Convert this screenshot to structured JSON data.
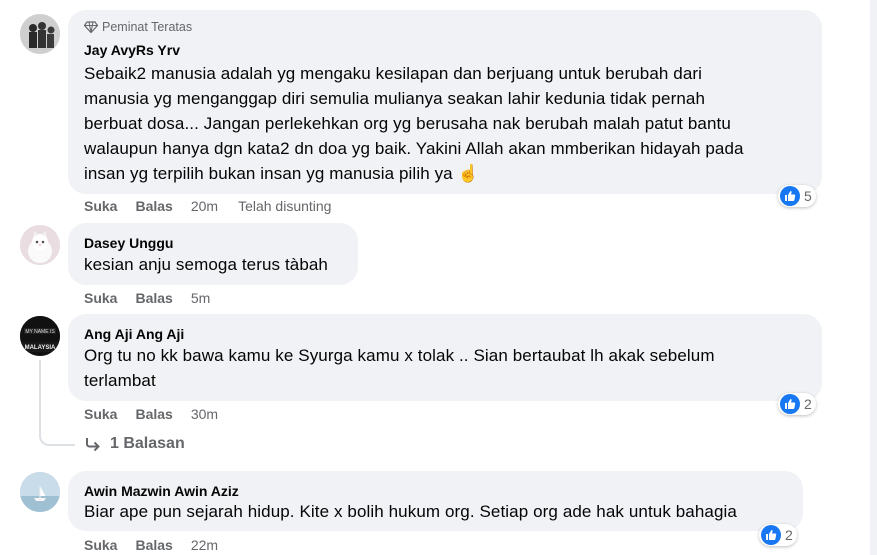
{
  "comments": [
    {
      "badge": "Peminat Teratas",
      "author": "Jay AvyRs Yrv",
      "lines": [
        "Sebaik2 manusia adalah yg mengaku kesilapan dan berjuang untuk berubah dari",
        "manusia yg menganggap diri semulia mulianya seakan lahir kedunia tidak pernah",
        "berbuat dosa... Jangan perlekehkan org yg berusaha nak berubah malah patut bantu",
        "walaupun hanya dgn kata2 dn doa yg baik. Yakini Allah akan mmberikan hidayah pada",
        "insan yg terpilih bukan insan yg manusia pilih ya ☝️"
      ],
      "like": "Suka",
      "reply": "Balas",
      "time": "20m",
      "edited": "Telah disunting",
      "reactions": "5"
    },
    {
      "author": "Dasey Unggu",
      "lines": [
        "kesian anju semoga terus tàbah"
      ],
      "like": "Suka",
      "reply": "Balas",
      "time": "5m"
    },
    {
      "author": "Ang Aji Ang Aji",
      "lines": [
        "Org tu no kk bawa kamu ke Syurga kamu x tolak .. Sian bertaubat lh akak sebelum",
        "terlambat"
      ],
      "like": "Suka",
      "reply": "Balas",
      "time": "30m",
      "reactions": "2",
      "replies_label": "1 Balasan"
    },
    {
      "author": "Awin Mazwin Awin Aziz",
      "lines": [
        "Biar ape pun sejarah hidup. Kite x bolih hukum org. Setiap org ade hak untuk bahagia"
      ],
      "like": "Suka",
      "reply": "Balas",
      "time": "22m",
      "reactions": "2"
    }
  ],
  "colors": {
    "accent": "#1877f2",
    "bubble": "#f0f2f5",
    "muted": "#65676b"
  }
}
